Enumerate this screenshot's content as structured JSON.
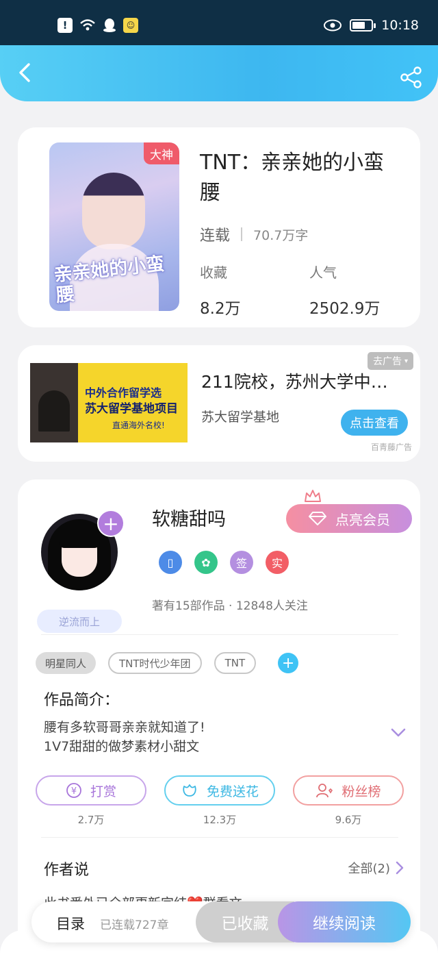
{
  "status_bar": {
    "time": "10:18",
    "icons": [
      "alert-icon",
      "wifi-icon",
      "qq-icon",
      "app-icon",
      "eye-icon",
      "battery-icon"
    ],
    "battery_level": 0.7
  },
  "header": {
    "back_icon": "back-arrow-icon",
    "share_icon": "share-icon",
    "gradient": [
      "#57cff5",
      "#3db7f0"
    ]
  },
  "book": {
    "title": "TNT：亲亲她的小蛮腰",
    "cover_title": "亲亲她的小蛮腰",
    "badge": "大神",
    "status": "连载",
    "word_count": "70.7万字",
    "favorites_label": "收藏",
    "favorites_value": "8.2万",
    "popularity_label": "人气",
    "popularity_value": "2502.9万"
  },
  "ad": {
    "title": "211院校，苏州大学中…",
    "subtitle": "苏大留学基地",
    "remove_label": "去广告",
    "button_label": "点击查看",
    "source": "百青藤广告",
    "image_line1": "中外合作留学选",
    "image_line2": "苏大留学基地项目",
    "image_line3": "直通海外名校!"
  },
  "author": {
    "name": "软糖甜吗",
    "vip_button": "点亮会员",
    "rank_badge": "逆流而上",
    "honors": [
      "",
      "",
      "签",
      "实"
    ],
    "stats": "著有15部作品 · 12848人关注",
    "tags": [
      "明星同人",
      "TNT时代少年团",
      "TNT"
    ],
    "intro_heading": "作品简介：",
    "intro_line1": "腰有多软哥哥亲亲就知道了!",
    "intro_line2": "1V7甜甜的做梦素材小甜文",
    "actions": [
      {
        "label": "打赏",
        "count": "2.7万",
        "icon": "yen-icon"
      },
      {
        "label": "免费送花",
        "count": "12.3万",
        "icon": "flower-icon"
      },
      {
        "label": "粉丝榜",
        "count": "9.6万",
        "icon": "fans-icon"
      }
    ],
    "author_say_heading": "作者说",
    "author_say_all": "全部(2)",
    "author_say_peek": "此书番外已全部更新完结❤️群看文..."
  },
  "bottom_bar": {
    "toc_label": "目录",
    "chapters": "已连载727章",
    "collected_label": "已收藏",
    "read_label": "继续阅读"
  }
}
